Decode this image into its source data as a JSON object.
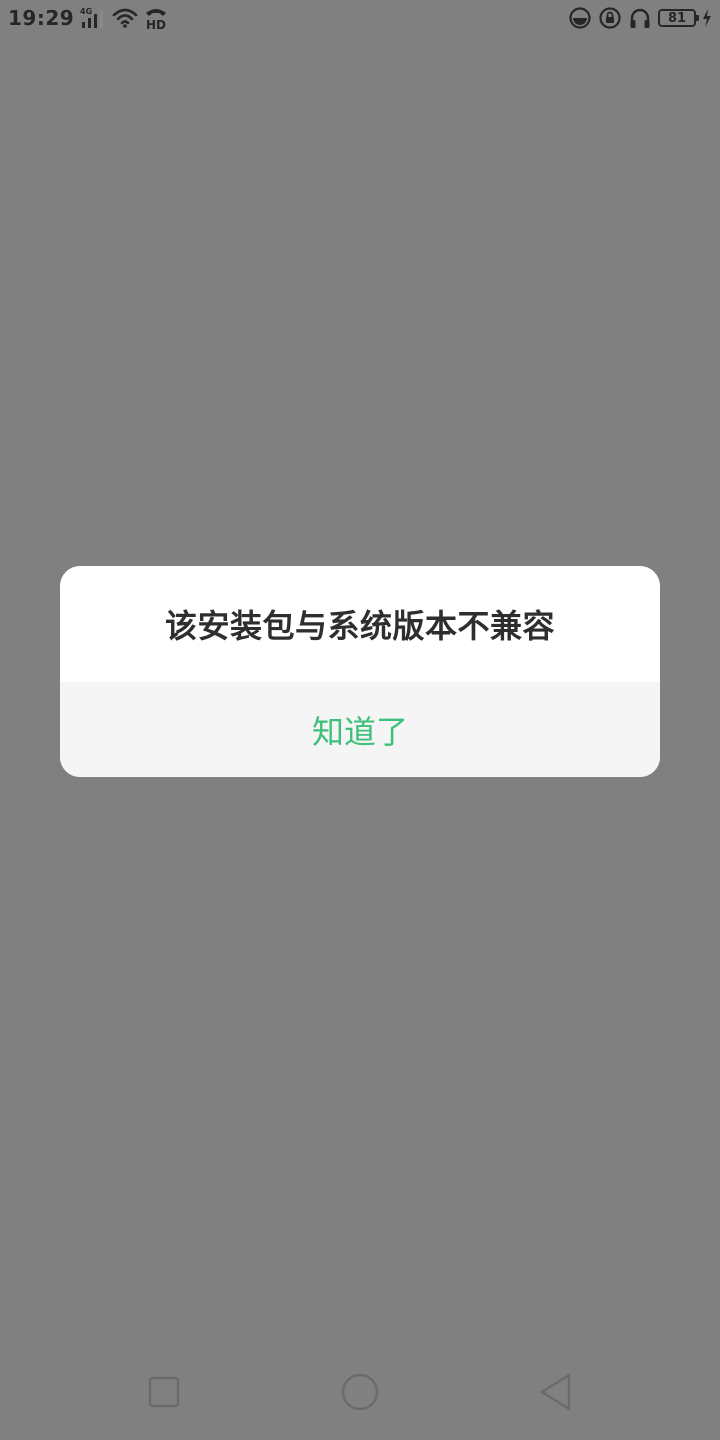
{
  "status_bar": {
    "time": "19:29",
    "network_type": "4G",
    "hd_label": "HD",
    "battery_level": "81",
    "icons": [
      "signal-icon",
      "wifi-icon",
      "hd-call-icon",
      "vpn-icon",
      "lock-rotation-icon",
      "headphones-icon",
      "battery-icon",
      "charging-icon"
    ]
  },
  "dialog": {
    "message": "该安装包与系统版本不兼容",
    "confirm_label": "知道了"
  },
  "nav_bar": {
    "icons": [
      "recent-apps-icon",
      "home-icon",
      "back-icon"
    ]
  },
  "colors": {
    "overlay": "#808080",
    "dialog_bg": "#ffffff",
    "button_bg": "#f5f5f5",
    "accent": "#3cc07a",
    "text": "#2e2e2e"
  }
}
